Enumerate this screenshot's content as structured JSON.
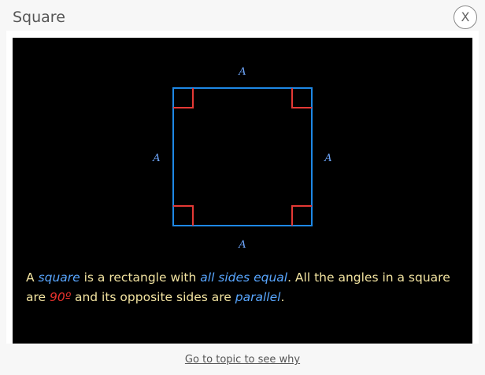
{
  "dialog": {
    "title": "Square",
    "close_label": "X"
  },
  "figure": {
    "shape": "square",
    "side_labels": {
      "top": "A",
      "left": "A",
      "right": "A",
      "bottom": "A"
    },
    "colors": {
      "square_outline": "#1e88e5",
      "right_angle_marks": "#e53935",
      "labels": "#6fa8ff"
    }
  },
  "description": {
    "t1": "A ",
    "h1": "square",
    "t2": " is a rectangle with ",
    "h2": "all sides equal",
    "t3": ". All the angles in a square are ",
    "r1": "90º",
    "t4": " and its opposite sides are ",
    "h3": "parallel",
    "t5": "."
  },
  "footer": {
    "link_label": "Go to topic to see why"
  }
}
